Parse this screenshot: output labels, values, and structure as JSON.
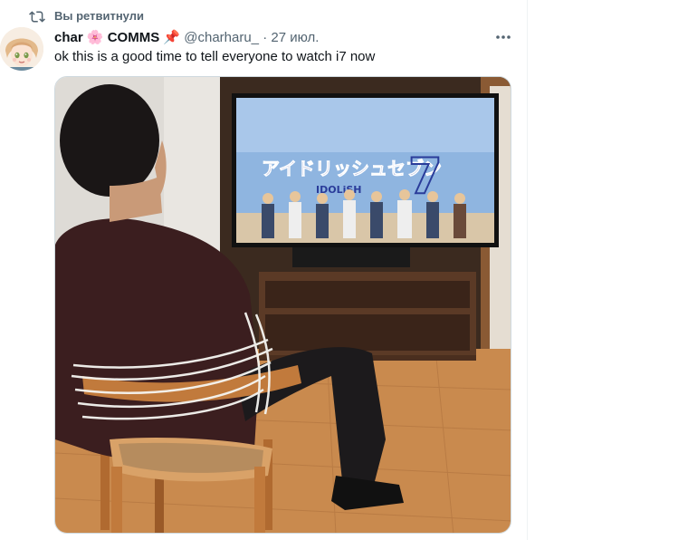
{
  "retweet": {
    "icon": "retweet-icon",
    "label": "Вы ретвитнули"
  },
  "tweet": {
    "author_name": "char",
    "author_suffix": "COMMS",
    "emoji_flower": "🌸",
    "emoji_pin": "📌",
    "handle": "@charharu_",
    "separator": "·",
    "date": "27 июл.",
    "text": "ok this is a good time to tell everyone to watch i7 now",
    "more_icon": "more-horizontal-icon",
    "avatar_icon": "anime-avatar"
  },
  "media": {
    "tv_title_jp": "アイドリッシュセブン",
    "tv_title_en": "IDOLiSH",
    "tv_logo_number": "7"
  },
  "colors": {
    "secondary_text": "#536471",
    "primary_text": "#0f1419",
    "border": "#cfd9de"
  }
}
